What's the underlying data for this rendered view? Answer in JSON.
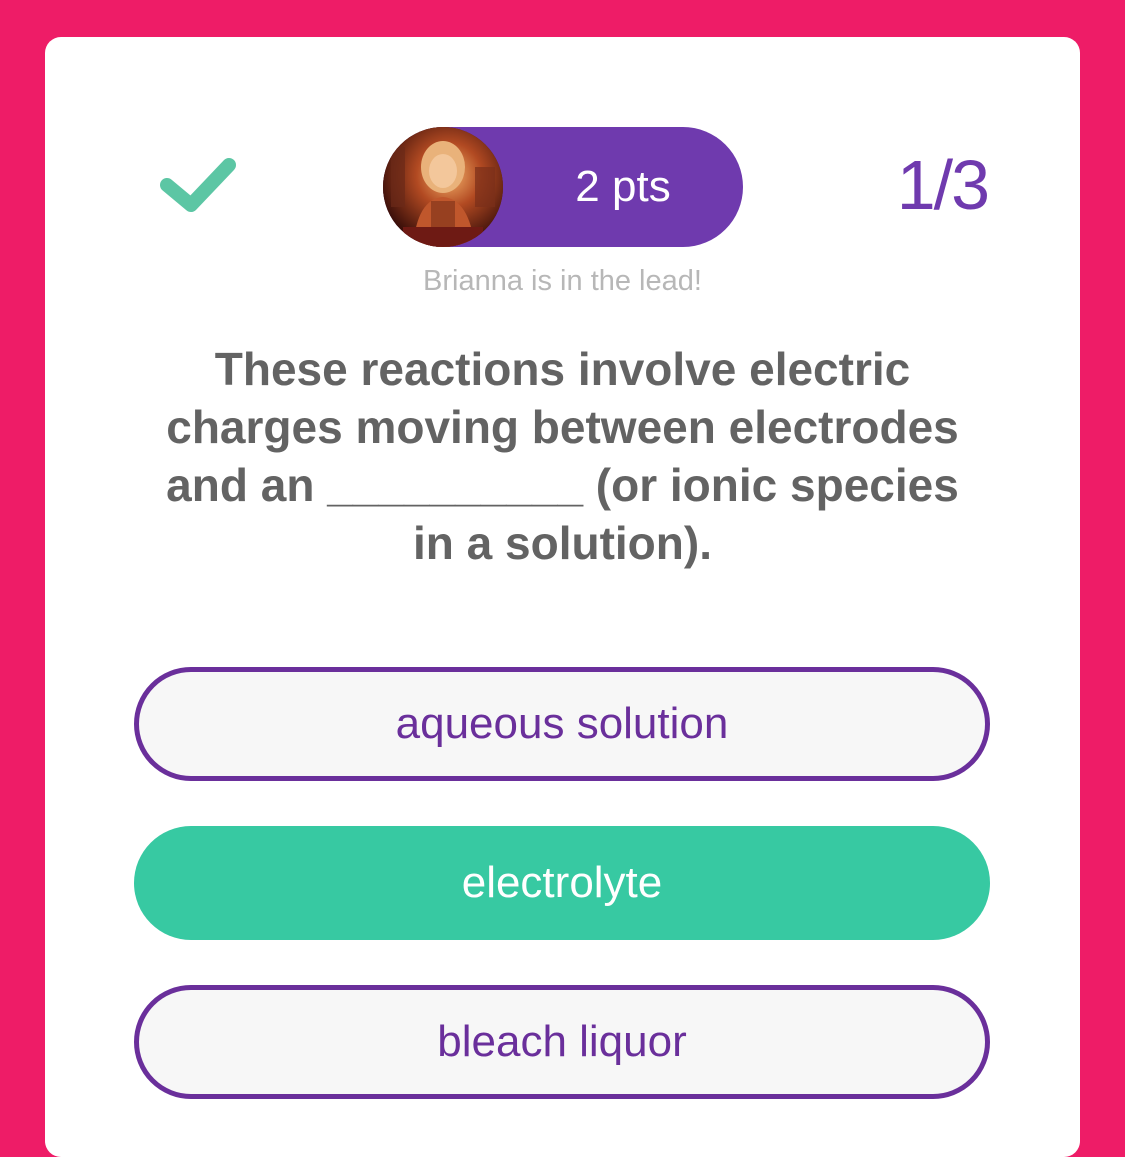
{
  "header": {
    "status_icon": "checkmark-icon",
    "points_label": "2 pts",
    "progress_label": "1/3",
    "lead_message": "Brianna is in the lead!"
  },
  "question": {
    "text": "These reactions involve electric charges moving between electrodes and an __________ (or ionic species in a solution)."
  },
  "answers": [
    {
      "label": "aqueous solution",
      "state": "default"
    },
    {
      "label": "electrolyte",
      "state": "correct"
    },
    {
      "label": "bleach liquor",
      "state": "default"
    }
  ],
  "colors": {
    "background": "#EE1C67",
    "accent_purple": "#6F3AAE",
    "correct_green": "#37C9A2",
    "check_green": "#5CC6A4"
  }
}
